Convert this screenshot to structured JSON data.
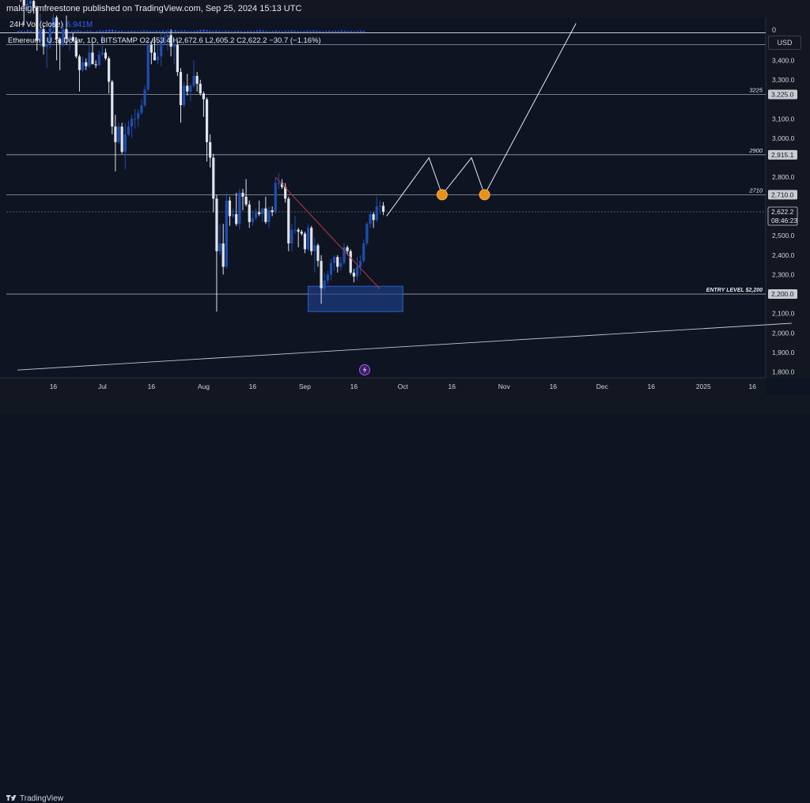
{
  "header": {
    "publisher": "maleighmfreestone published on TradingView.com, Sep 25, 2024 15:13 UTC"
  },
  "volume_pane": {
    "label": "24H Vol (close)",
    "value": "6.941M",
    "scale_zero": "0"
  },
  "symbol_line": "Ethereum / U.S. Dollar, 1D, BITSTAMP  O2,653.4  H2,672.6  L2,605.2  C2,622.2  −30.7 (−1.16%)",
  "currency_button": "USD",
  "footer": {
    "brand": "TradingView"
  },
  "colors": {
    "background": "#0e1421",
    "bull_candle": "#1e4fb0",
    "bear_candle": "#e0e3eb",
    "entry_box": "#1d3f8a",
    "target_marker": "#e8901c",
    "trendline": "#b23b3b",
    "forecast_path": "#e6e8ee"
  },
  "chart_data": {
    "type": "candlestick",
    "symbol": "Ethereum / U.S. Dollar",
    "interval": "1D",
    "exchange": "BITSTAMP",
    "ohlc_last": {
      "open": 2653.4,
      "high": 2672.6,
      "low": 2605.2,
      "close": 2622.2,
      "change": -30.7,
      "change_pct": -1.16
    },
    "y_ticks": [
      "3,400.0",
      "3,300.0",
      "3,100.0",
      "3,000.0",
      "2,800.0",
      "2,600.0",
      "2,500.0",
      "2,400.0",
      "2,300.0",
      "2,100.0",
      "2,000.0",
      "1,900.0",
      "1,800.0"
    ],
    "y_tick_values": [
      3400,
      3300,
      3100,
      3000,
      2800,
      2600,
      2500,
      2400,
      2300,
      2100,
      2000,
      1900,
      1800
    ],
    "ylim": [
      1770,
      3580
    ],
    "x_ticks": [
      {
        "label": "16",
        "date": "2024-06-16"
      },
      {
        "label": "Jul",
        "date": "2024-07-01"
      },
      {
        "label": "16",
        "date": "2024-07-16"
      },
      {
        "label": "Aug",
        "date": "2024-08-01"
      },
      {
        "label": "16",
        "date": "2024-08-16"
      },
      {
        "label": "Sep",
        "date": "2024-09-01"
      },
      {
        "label": "16",
        "date": "2024-09-16"
      },
      {
        "label": "Oct",
        "date": "2024-10-01"
      },
      {
        "label": "16",
        "date": "2024-10-16"
      },
      {
        "label": "Nov",
        "date": "2024-11-01"
      },
      {
        "label": "16",
        "date": "2024-11-16"
      },
      {
        "label": "Dec",
        "date": "2024-12-01"
      },
      {
        "label": "16",
        "date": "2024-12-16"
      },
      {
        "label": "2025",
        "date": "2025-01-01"
      },
      {
        "label": "16",
        "date": "2025-01-16"
      }
    ],
    "horizontal_levels": [
      {
        "label": "",
        "price": 3480,
        "badge": ""
      },
      {
        "label": "3225",
        "price": 3225,
        "badge": "3,225.0"
      },
      {
        "label": "2900",
        "price": 2915.1,
        "badge": "2,915.1"
      },
      {
        "label": "2710",
        "price": 2710,
        "badge": "2,710.0"
      },
      {
        "label": "ENTRY LEVEL $2,200",
        "price": 2200,
        "badge": "2,200.0"
      }
    ],
    "current_price": {
      "value": "2,622.2",
      "countdown": "08:46:23",
      "price": 2622.2
    },
    "entry_zone": {
      "from": "2024-09-02",
      "to": "2024-10-01",
      "low": 2110,
      "high": 2240
    },
    "forecast_path": [
      {
        "date": "2024-09-26",
        "price": 2600
      },
      {
        "date": "2024-10-09",
        "price": 2900
      },
      {
        "date": "2024-10-13",
        "price": 2710
      },
      {
        "date": "2024-10-22",
        "price": 2900
      },
      {
        "date": "2024-10-26",
        "price": 2710
      },
      {
        "date": "2024-11-23",
        "price": 3590
      }
    ],
    "target_markers": [
      {
        "date": "2024-10-13",
        "price": 2710
      },
      {
        "date": "2024-10-26",
        "price": 2710
      }
    ],
    "trendline": {
      "from": {
        "date": "2024-08-23",
        "price": 2800
      },
      "to": {
        "date": "2024-09-24",
        "price": 2225
      }
    },
    "long_support": {
      "from": {
        "date": "2024-06-05",
        "price": 1810
      },
      "to": {
        "date": "2025-01-28",
        "price": 2050
      }
    },
    "candles": [
      [
        "2024-06-05",
        3760,
        3880,
        3720,
        3810
      ],
      [
        "2024-06-06",
        3810,
        3840,
        3700,
        3710
      ],
      [
        "2024-06-07",
        3710,
        3760,
        3580,
        3680
      ],
      [
        "2024-06-08",
        3680,
        3710,
        3650,
        3690
      ],
      [
        "2024-06-09",
        3690,
        3730,
        3660,
        3705
      ],
      [
        "2024-06-10",
        3705,
        3715,
        3640,
        3670
      ],
      [
        "2024-06-11",
        3670,
        3680,
        3450,
        3500
      ],
      [
        "2024-06-12",
        3500,
        3640,
        3470,
        3560
      ],
      [
        "2024-06-13",
        3560,
        3580,
        3430,
        3470
      ],
      [
        "2024-06-14",
        3470,
        3520,
        3360,
        3480
      ],
      [
        "2024-06-15",
        3480,
        3590,
        3460,
        3565
      ],
      [
        "2024-06-16",
        3565,
        3640,
        3540,
        3620
      ],
      [
        "2024-06-17",
        3620,
        3630,
        3400,
        3510
      ],
      [
        "2024-06-18",
        3510,
        3520,
        3350,
        3485
      ],
      [
        "2024-06-19",
        3485,
        3590,
        3470,
        3560
      ],
      [
        "2024-06-20",
        3560,
        3630,
        3480,
        3510
      ],
      [
        "2024-06-21",
        3510,
        3530,
        3450,
        3520
      ],
      [
        "2024-06-22",
        3520,
        3540,
        3500,
        3500
      ],
      [
        "2024-06-23",
        3500,
        3520,
        3410,
        3420
      ],
      [
        "2024-06-24",
        3420,
        3430,
        3240,
        3350
      ],
      [
        "2024-06-25",
        3350,
        3420,
        3340,
        3390
      ],
      [
        "2024-06-26",
        3390,
        3410,
        3350,
        3370
      ],
      [
        "2024-06-27",
        3370,
        3480,
        3360,
        3440
      ],
      [
        "2024-06-28",
        3440,
        3490,
        3390,
        3380
      ],
      [
        "2024-06-29",
        3380,
        3400,
        3360,
        3375
      ],
      [
        "2024-06-30",
        3375,
        3450,
        3370,
        3430
      ],
      [
        "2024-07-01",
        3430,
        3530,
        3420,
        3440
      ],
      [
        "2024-07-02",
        3440,
        3460,
        3400,
        3410
      ],
      [
        "2024-07-03",
        3410,
        3420,
        3230,
        3290
      ],
      [
        "2024-07-04",
        3290,
        3300,
        3020,
        3060
      ],
      [
        "2024-07-05",
        3060,
        3120,
        2830,
        2980
      ],
      [
        "2024-07-06",
        2980,
        3080,
        2970,
        3060
      ],
      [
        "2024-07-07",
        3060,
        3080,
        2920,
        2930
      ],
      [
        "2024-07-08",
        2930,
        3080,
        2840,
        3020
      ],
      [
        "2024-07-09",
        3020,
        3090,
        3010,
        3060
      ],
      [
        "2024-07-10",
        3060,
        3120,
        3000,
        3100
      ],
      [
        "2024-07-11",
        3100,
        3150,
        3050,
        3100
      ],
      [
        "2024-07-12",
        3100,
        3150,
        3060,
        3130
      ],
      [
        "2024-07-13",
        3130,
        3200,
        3120,
        3170
      ],
      [
        "2024-07-14",
        3170,
        3270,
        3160,
        3250
      ],
      [
        "2024-07-15",
        3250,
        3500,
        3240,
        3480
      ],
      [
        "2024-07-16",
        3480,
        3500,
        3380,
        3440
      ],
      [
        "2024-07-17",
        3440,
        3520,
        3400,
        3400
      ],
      [
        "2024-07-18",
        3400,
        3500,
        3380,
        3420
      ],
      [
        "2024-07-19",
        3420,
        3540,
        3370,
        3500
      ],
      [
        "2024-07-20",
        3500,
        3540,
        3480,
        3520
      ],
      [
        "2024-07-21",
        3520,
        3560,
        3450,
        3530
      ],
      [
        "2024-07-22",
        3530,
        3560,
        3420,
        3470
      ],
      [
        "2024-07-23",
        3470,
        3520,
        3380,
        3480
      ],
      [
        "2024-07-24",
        3480,
        3500,
        3320,
        3340
      ],
      [
        "2024-07-25",
        3340,
        3360,
        3080,
        3170
      ],
      [
        "2024-07-26",
        3170,
        3290,
        3160,
        3270
      ],
      [
        "2024-07-27",
        3270,
        3330,
        3220,
        3240
      ],
      [
        "2024-07-28",
        3240,
        3280,
        3190,
        3270
      ],
      [
        "2024-07-29",
        3270,
        3400,
        3260,
        3320
      ],
      [
        "2024-07-30",
        3320,
        3340,
        3240,
        3280
      ],
      [
        "2024-07-31",
        3280,
        3300,
        3220,
        3230
      ],
      [
        "2024-08-01",
        3230,
        3240,
        3110,
        3200
      ],
      [
        "2024-08-02",
        3200,
        3210,
        2880,
        2980
      ],
      [
        "2024-08-03",
        2980,
        3020,
        2850,
        2900
      ],
      [
        "2024-08-04",
        2900,
        2920,
        2620,
        2690
      ],
      [
        "2024-08-05",
        2690,
        2710,
        2110,
        2420
      ],
      [
        "2024-08-06",
        2420,
        2560,
        2400,
        2460
      ],
      [
        "2024-08-07",
        2460,
        2560,
        2300,
        2340
      ],
      [
        "2024-08-08",
        2340,
        2720,
        2330,
        2680
      ],
      [
        "2024-08-09",
        2680,
        2700,
        2550,
        2600
      ],
      [
        "2024-08-10",
        2600,
        2640,
        2590,
        2610
      ],
      [
        "2024-08-11",
        2610,
        2720,
        2550,
        2560
      ],
      [
        "2024-08-12",
        2560,
        2740,
        2530,
        2720
      ],
      [
        "2024-08-13",
        2720,
        2740,
        2630,
        2700
      ],
      [
        "2024-08-14",
        2700,
        2790,
        2650,
        2660
      ],
      [
        "2024-08-15",
        2660,
        2680,
        2540,
        2570
      ],
      [
        "2024-08-16",
        2570,
        2630,
        2550,
        2590
      ],
      [
        "2024-08-17",
        2590,
        2640,
        2580,
        2620
      ],
      [
        "2024-08-18",
        2620,
        2680,
        2600,
        2610
      ],
      [
        "2024-08-19",
        2610,
        2640,
        2570,
        2640
      ],
      [
        "2024-08-20",
        2640,
        2700,
        2560,
        2570
      ],
      [
        "2024-08-21",
        2570,
        2650,
        2540,
        2630
      ],
      [
        "2024-08-22",
        2630,
        2650,
        2600,
        2620
      ],
      [
        "2024-08-23",
        2620,
        2800,
        2610,
        2770
      ],
      [
        "2024-08-24",
        2770,
        2820,
        2740,
        2770
      ],
      [
        "2024-08-25",
        2770,
        2790,
        2740,
        2750
      ],
      [
        "2024-08-26",
        2750,
        2770,
        2670,
        2690
      ],
      [
        "2024-08-27",
        2690,
        2700,
        2420,
        2460
      ],
      [
        "2024-08-28",
        2460,
        2560,
        2420,
        2530
      ],
      [
        "2024-08-29",
        2530,
        2600,
        2510,
        2530
      ],
      [
        "2024-08-30",
        2530,
        2540,
        2440,
        2520
      ],
      [
        "2024-08-31",
        2520,
        2530,
        2500,
        2510
      ],
      [
        "2024-09-01",
        2510,
        2520,
        2410,
        2430
      ],
      [
        "2024-09-02",
        2430,
        2560,
        2420,
        2540
      ],
      [
        "2024-09-03",
        2540,
        2550,
        2400,
        2420
      ],
      [
        "2024-09-04",
        2420,
        2490,
        2310,
        2450
      ],
      [
        "2024-09-05",
        2450,
        2460,
        2340,
        2370
      ],
      [
        "2024-09-06",
        2370,
        2400,
        2150,
        2230
      ],
      [
        "2024-09-07",
        2230,
        2310,
        2210,
        2270
      ],
      [
        "2024-09-08",
        2270,
        2320,
        2250,
        2300
      ],
      [
        "2024-09-09",
        2300,
        2380,
        2270,
        2360
      ],
      [
        "2024-09-10",
        2360,
        2400,
        2320,
        2390
      ],
      [
        "2024-09-11",
        2390,
        2400,
        2310,
        2340
      ],
      [
        "2024-09-12",
        2340,
        2390,
        2320,
        2360
      ],
      [
        "2024-09-13",
        2360,
        2460,
        2350,
        2440
      ],
      [
        "2024-09-14",
        2440,
        2450,
        2400,
        2420
      ],
      [
        "2024-09-15",
        2420,
        2430,
        2300,
        2310
      ],
      [
        "2024-09-16",
        2310,
        2330,
        2260,
        2290
      ],
      [
        "2024-09-17",
        2290,
        2390,
        2270,
        2340
      ],
      [
        "2024-09-18",
        2340,
        2400,
        2300,
        2370
      ],
      [
        "2024-09-19",
        2370,
        2480,
        2360,
        2460
      ],
      [
        "2024-09-20",
        2460,
        2570,
        2450,
        2560
      ],
      [
        "2024-09-21",
        2560,
        2620,
        2540,
        2610
      ],
      [
        "2024-09-22",
        2610,
        2620,
        2540,
        2580
      ],
      [
        "2024-09-23",
        2580,
        2700,
        2570,
        2650
      ],
      [
        "2024-09-24",
        2650,
        2680,
        2610,
        2653.4
      ],
      [
        "2024-09-25",
        2653.4,
        2672.6,
        2605.2,
        2622.2
      ]
    ],
    "volume_bars_note_free": [
      0.5,
      0.6,
      0.4,
      0.7,
      0.5,
      0.3,
      0.6,
      0.8,
      0.5,
      0.4,
      0.6,
      0.5,
      0.7,
      0.4,
      0.5,
      0.6,
      0.4,
      0.5,
      0.6,
      0.7,
      0.5,
      0.4,
      0.6,
      0.5,
      0.3,
      0.5,
      0.7,
      0.6,
      0.8,
      0.9,
      1.0,
      0.7,
      0.5,
      0.6,
      0.4,
      0.5,
      0.6,
      0.5,
      0.4,
      0.5,
      0.7,
      0.6,
      0.5,
      0.4,
      0.6,
      0.5,
      0.7,
      0.5,
      0.4,
      0.6,
      0.8,
      0.5,
      0.6,
      0.7,
      0.5,
      0.4,
      0.5,
      0.6,
      0.9,
      1.0,
      0.8,
      0.6,
      0.5,
      0.7,
      0.5,
      0.4,
      0.6,
      0.5,
      0.4,
      0.5,
      0.6,
      0.5,
      0.4,
      0.5,
      0.6,
      0.5,
      0.7,
      0.8,
      0.6,
      0.5,
      0.4,
      0.5,
      0.6,
      0.5,
      0.4,
      0.6,
      0.5,
      0.7,
      0.6,
      0.5,
      0.4,
      0.5,
      0.6,
      0.5,
      0.7,
      0.6,
      0.5,
      0.4,
      0.5,
      0.6,
      0.5,
      0.6,
      0.5,
      0.7,
      0.6,
      0.5,
      0.5,
      0.4,
      0.5,
      0.6,
      0.5,
      0.4,
      0.3
    ]
  }
}
